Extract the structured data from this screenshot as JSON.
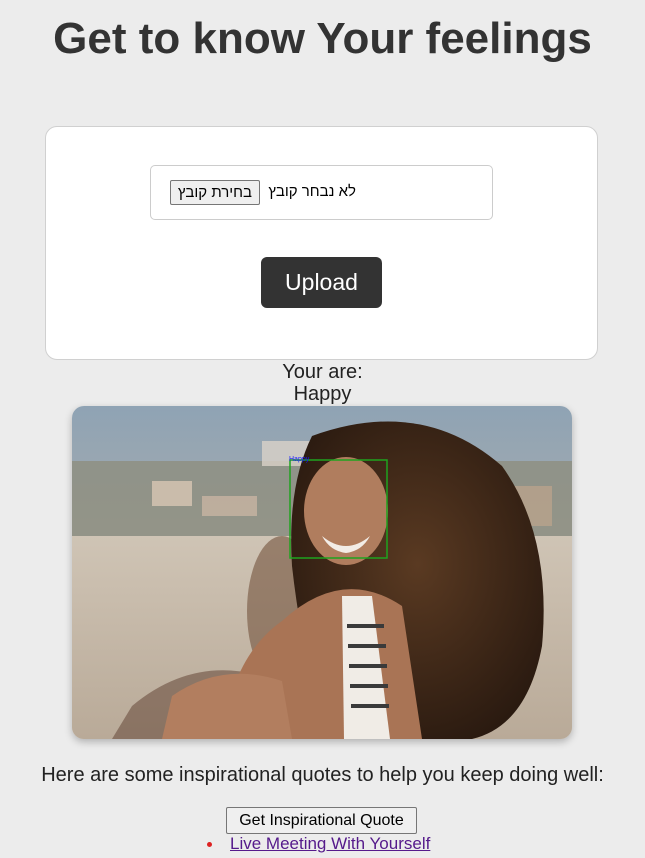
{
  "page": {
    "title": "Get to know Your feelings"
  },
  "upload_form": {
    "file_button_label": "בחירת קובץ",
    "file_status": "לא נבחר קובץ",
    "upload_button_label": "Upload"
  },
  "result": {
    "label": "Your are:",
    "emotion": "Happy",
    "face_box_label": "Happy",
    "face_box_color": "#1fa31f",
    "face_label_color": "#1a1aff"
  },
  "quotes": {
    "intro_text": "Here are some inspirational quotes to help you keep doing well:",
    "button_label": "Get Inspirational Quote",
    "items": [
      {
        "title": "Live Meeting With Yourself"
      }
    ]
  },
  "colors": {
    "background": "#ececec",
    "upload_button": "#333333",
    "link": "#551a8b",
    "bullet": "#dd2222"
  }
}
